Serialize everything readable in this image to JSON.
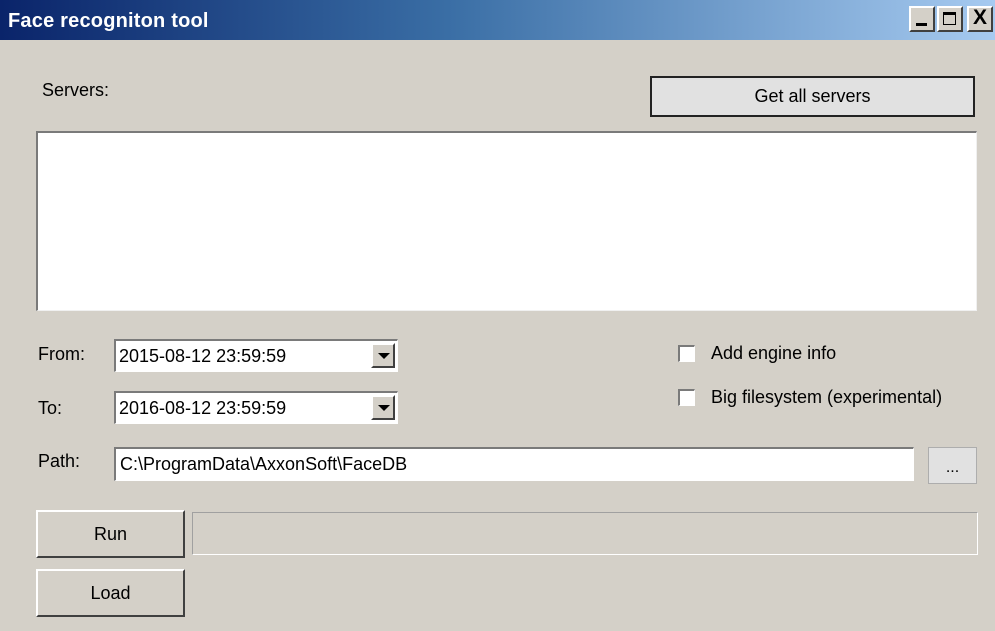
{
  "window": {
    "title": "Face recogniton tool",
    "controls": {
      "minimize_icon": "minimize-icon",
      "maximize_icon": "maximize-icon",
      "close_icon": "close-icon",
      "close_glyph": "X"
    }
  },
  "servers": {
    "label": "Servers:",
    "get_all_button": "Get all servers",
    "list_items": []
  },
  "from": {
    "label": "From:",
    "value": "2015-08-12 23:59:59"
  },
  "to": {
    "label": "To:",
    "value": "2016-08-12 23:59:59"
  },
  "options": {
    "add_engine_info": {
      "label": "Add engine info",
      "checked": false
    },
    "big_filesystem": {
      "label": "Big filesystem (experimental)",
      "checked": false
    }
  },
  "path": {
    "label": "Path:",
    "value": "C:\\ProgramData\\AxxonSoft\\FaceDB",
    "browse_label": "..."
  },
  "actions": {
    "run_label": "Run",
    "load_label": "Load",
    "progress": 0
  },
  "colors": {
    "face": "#d4d0c8",
    "title_start": "#0a246a",
    "title_end": "#a6caf0"
  }
}
